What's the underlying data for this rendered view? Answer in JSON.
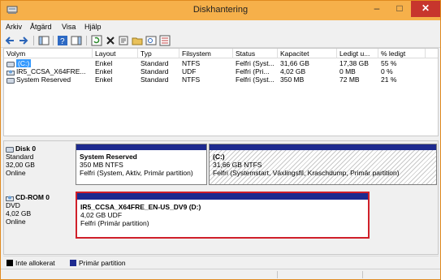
{
  "window": {
    "title": "Diskhantering",
    "min_glyph": "–",
    "max_glyph": "□",
    "close_glyph": "✕",
    "frame_color": "#f6b04a",
    "close_color": "#c7352d"
  },
  "menu": {
    "items": [
      "Arkiv",
      "Åtgärd",
      "Visa",
      "Hjälp"
    ]
  },
  "toolbar": {
    "icons": [
      "back-arrow-icon",
      "forward-arrow-icon",
      "console-tree-icon",
      "help-icon",
      "properties-list-icon",
      "refresh-icon",
      "delete-icon",
      "properties-icon",
      "open-folder-icon",
      "zoom-icon",
      "settings-icon"
    ]
  },
  "volumes": {
    "columns": [
      "Volym",
      "Layout",
      "Typ",
      "Filsystem",
      "Status",
      "Kapacitet",
      "Ledigt u...",
      "% ledigt"
    ],
    "rows": [
      {
        "volym": "(C:)",
        "layout": "Enkel",
        "typ": "Standard",
        "fs": "NTFS",
        "status": "Felfri (Syst...",
        "kapacitet": "31,66 GB",
        "ledigt": "17,38 GB",
        "pct": "55 %",
        "icon": "volume-icon",
        "selected": true
      },
      {
        "volym": "IR5_CCSA_X64FRE...",
        "layout": "Enkel",
        "typ": "Standard",
        "fs": "UDF",
        "status": "Felfri (Pri...",
        "kapacitet": "4,02 GB",
        "ledigt": "0 MB",
        "pct": "0 %",
        "icon": "dvd-icon",
        "selected": false
      },
      {
        "volym": "System Reserved",
        "layout": "Enkel",
        "typ": "Standard",
        "fs": "NTFS",
        "status": "Felfri (Syst...",
        "kapacitet": "350 MB",
        "ledigt": "72 MB",
        "pct": "21 %",
        "icon": "volume-icon",
        "selected": false
      }
    ]
  },
  "disks": [
    {
      "name": "Disk 0",
      "type": "Standard",
      "size": "32,00 GB",
      "status": "Online",
      "icon": "disk-icon",
      "partitions": [
        {
          "title": "System Reserved",
          "line2": "350 MB NTFS",
          "line3": "Felfri (System, Aktiv, Primär partition)"
        },
        {
          "title": "(C:)",
          "line2": "31,66 GB NTFS",
          "line3": "Felfri (Systemstart, Växlingsfil, Kraschdump, Primär partition)"
        }
      ]
    },
    {
      "name": "CD-ROM 0",
      "type": "DVD",
      "size": "4,02 GB",
      "status": "Online",
      "icon": "cdrom-icon",
      "partitions": [
        {
          "title": "IR5_CCSA_X64FRE_EN-US_DV9  (D:)",
          "line2": "4,02 GB UDF",
          "line3": "Felfri (Primär partition)"
        }
      ]
    }
  ],
  "legend": [
    {
      "label": "Inte allokerat",
      "color": "#000000"
    },
    {
      "label": "Primär partition",
      "color": "#1d2a8f"
    }
  ],
  "colors": {
    "primary_partition": "#1d2a8f",
    "selection": "#3399ff",
    "selected_partition_border": "#d0202a"
  }
}
